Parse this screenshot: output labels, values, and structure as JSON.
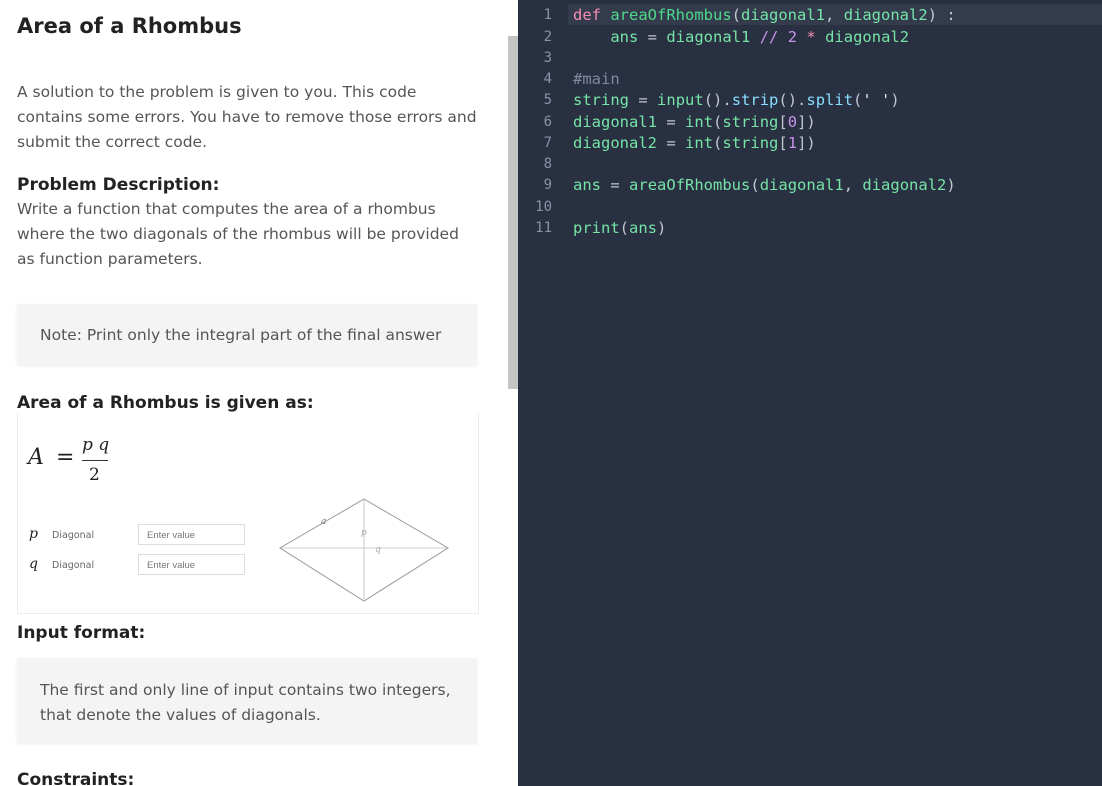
{
  "problem": {
    "title": "Area of a Rhombus",
    "intro_lines": [
      "A solution to the problem is given to you. This code",
      "contains some errors. You have to remove those errors and",
      "submit the correct code."
    ],
    "description_heading": "Problem Description:",
    "description_lines": [
      "Write a function that computes the area of a rhombus",
      "where the two diagonals of the rhombus will be provided",
      "as function parameters."
    ],
    "note": "Note: Print only the integral part of the final answer",
    "area_heading": "Area of a Rhombus is given as:",
    "formula": {
      "lhs": "A",
      "eq": "=",
      "numerator": "p q",
      "denominator": "2"
    },
    "calculator": {
      "rows": [
        {
          "symbol": "p",
          "label": "Diagonal",
          "placeholder": "Enter value"
        },
        {
          "symbol": "q",
          "label": "Diagonal",
          "placeholder": "Enter value"
        }
      ],
      "diagram_labels": {
        "side": "a",
        "p": "p",
        "q": "q"
      }
    },
    "input_heading": "Input format:",
    "input_lines": [
      "The first and only line of input contains two integers,",
      "that denote the values of diagonals."
    ],
    "constraints_heading": "Constraints:"
  },
  "editor": {
    "line_numbers": [
      "1",
      "2",
      "3",
      "4",
      "5",
      "6",
      "7",
      "8",
      "9",
      "10",
      "11"
    ],
    "lines": [
      "def areaOfRhombus(diagonal1, diagonal2) :",
      "    ans = diagonal1 // 2 * diagonal2",
      "",
      "#main",
      "string = input().strip().split(' ')",
      "diagonal1 = int(string[0])",
      "diagonal2 = int(string[1])",
      "",
      "ans = areaOfRhombus(diagonal1, diagonal2)",
      "",
      "print(ans)"
    ],
    "tokens": {
      "def": "def",
      "fn": "areaOfRhombus",
      "d1": "diagonal1",
      "d2": "diagonal2",
      "ans": "ans",
      "floordiv": "//",
      "two": "2",
      "mul": "*",
      "comment": "#main",
      "string": "string",
      "input": "input",
      "strip": "strip",
      "split": "split",
      "int": "int",
      "zero": "0",
      "one": "1",
      "print": "print",
      "space_str": "' '"
    },
    "colors": {
      "background": "#283041",
      "keyword": "#f48fb1",
      "function": "#4ed98a",
      "number": "#c792ea",
      "comment": "#7f8aa3",
      "builtin": "#89ddff"
    }
  }
}
